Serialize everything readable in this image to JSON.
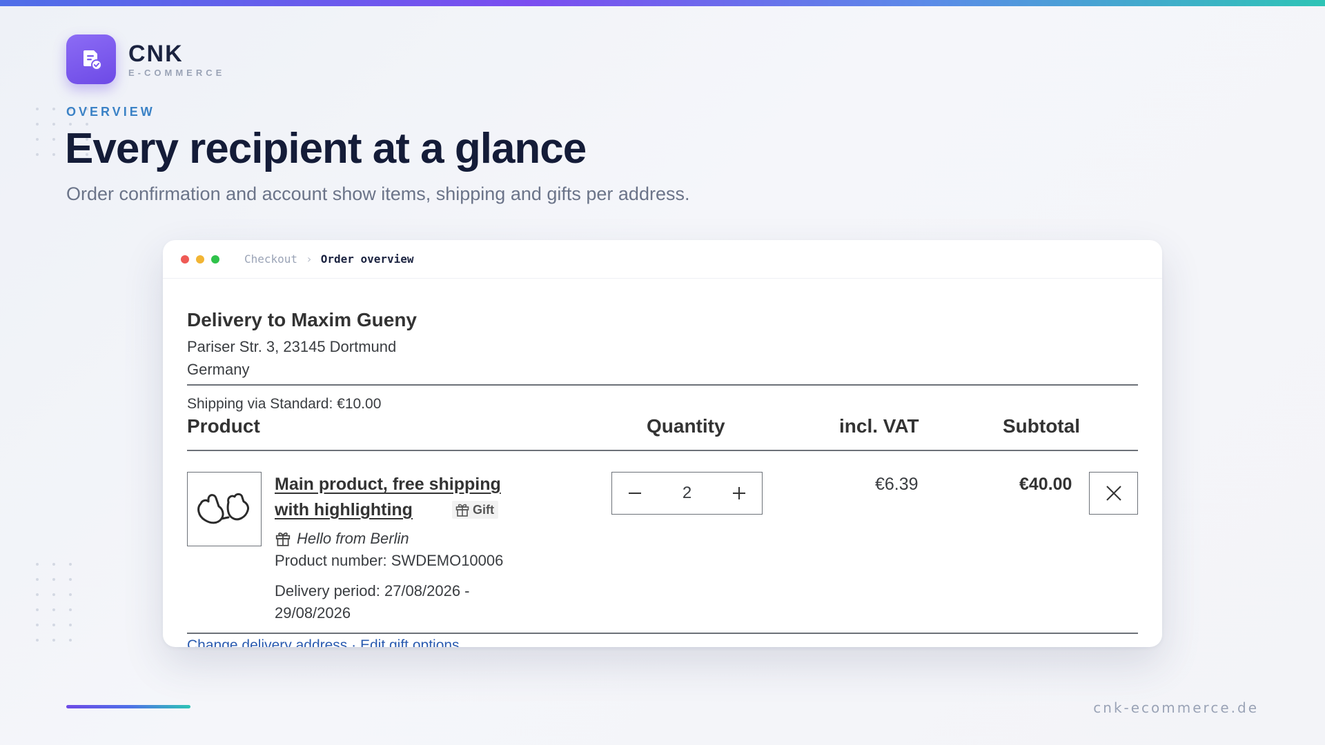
{
  "brand": {
    "name": "CNK",
    "subtitle": "E-COMMERCE",
    "logo_icon": "document-check-icon",
    "accent_color": "#7b4df0"
  },
  "hero": {
    "eyebrow": "OVERVIEW",
    "title": "Every recipient at a glance",
    "subtitle": "Order confirmation and account show items, shipping and gifts per address."
  },
  "window": {
    "breadcrumb": [
      "Checkout",
      "Order overview"
    ],
    "breadcrumb_separator": "›"
  },
  "delivery": {
    "title": "Delivery to Maxim Gueny",
    "address_line_1": "Pariser Str. 3, 23145 Dortmund",
    "address_line_2": "Germany",
    "shipping": "Shipping via Standard: €10.00"
  },
  "table": {
    "headers": {
      "product": "Product",
      "quantity": "Quantity",
      "vat": "incl. VAT",
      "subtotal": "Subtotal"
    }
  },
  "line_item": {
    "name_line_1": "Main product, free shipping",
    "name_line_2": "with highlighting",
    "gift_badge": "Gift",
    "gift_message": "Hello from Berlin",
    "product_number": "Product number: SWDEMO10006",
    "delivery_period_line_1": "Delivery period: 27/08/2026 -",
    "delivery_period_line_2": "29/08/2026",
    "quantity": "2",
    "vat": "€6.39",
    "subtotal": "€40.00",
    "thumbnail_icon": "mittens-icon"
  },
  "actions": {
    "links": "Change delivery address · Edit gift options"
  },
  "footer": {
    "url": "cnk-ecommerce.de"
  }
}
